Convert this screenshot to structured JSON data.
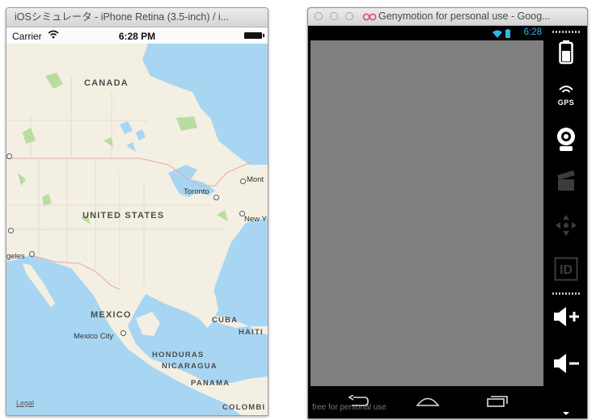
{
  "ios": {
    "window_title": "iOSシミュレータ - iPhone Retina (3.5-inch) / i...",
    "carrier": "Carrier",
    "time": "6:28 PM",
    "map": {
      "country_labels": [
        "CANADA",
        "UNITED STATES",
        "MEXICO",
        "CUBA",
        "HAITI",
        "HONDURAS",
        "NICARAGUA",
        "PANAMA",
        "COLOMBI"
      ],
      "city_labels": [
        "Toronto",
        "Mont",
        "New Y",
        "geles",
        "Mexico City"
      ],
      "legal": "Legal"
    },
    "colors": {
      "land": "#f3efe3",
      "water": "#a8d6f2",
      "park": "#b9dca0",
      "border": "#e6a8a8"
    }
  },
  "genymotion": {
    "window_title": "Genymotion for personal use - Goog...",
    "status_time": "6:28",
    "watermark": "free for personal use",
    "sidebar": {
      "gps_label": "GPS",
      "id_label": "ID",
      "icons": [
        "battery-icon",
        "gps-icon",
        "camera-icon",
        "clapboard-icon",
        "dpad-icon",
        "id-icon",
        "volume-up-icon",
        "volume-down-icon",
        "menu-arrow-icon"
      ]
    },
    "colors": {
      "screen": "#7f7f7f",
      "status_accent": "#33b5e5"
    }
  }
}
